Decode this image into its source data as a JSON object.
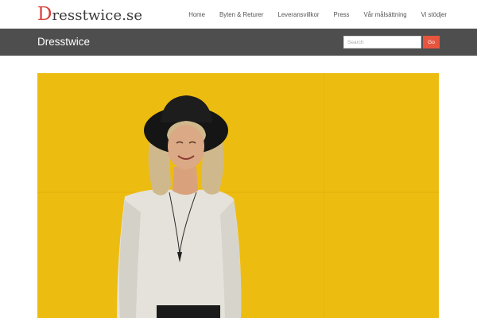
{
  "header": {
    "logo_initial": "D",
    "logo_rest": "resstwice.se",
    "nav": [
      {
        "label": "Home"
      },
      {
        "label": "Byten & Returer"
      },
      {
        "label": "Leveransvillkor"
      },
      {
        "label": "Press"
      },
      {
        "label": "Vår målsättning"
      },
      {
        "label": "Vi stödjer"
      }
    ]
  },
  "band": {
    "title": "Dresstwice",
    "search_placeholder": "Search",
    "search_value": "",
    "go_label": "Go"
  },
  "hero": {
    "icon": "photo-woman-yellow-wall",
    "colors": {
      "wall": "#ebb80a",
      "hat": "#151515",
      "sweater": "#e3e1d9",
      "hair": "#cfb98c",
      "skin": "#d9a27d"
    }
  },
  "colors": {
    "logo_accent": "#d9413a",
    "band_bg": "#4e4e4e",
    "go_button": "#e8553f"
  }
}
